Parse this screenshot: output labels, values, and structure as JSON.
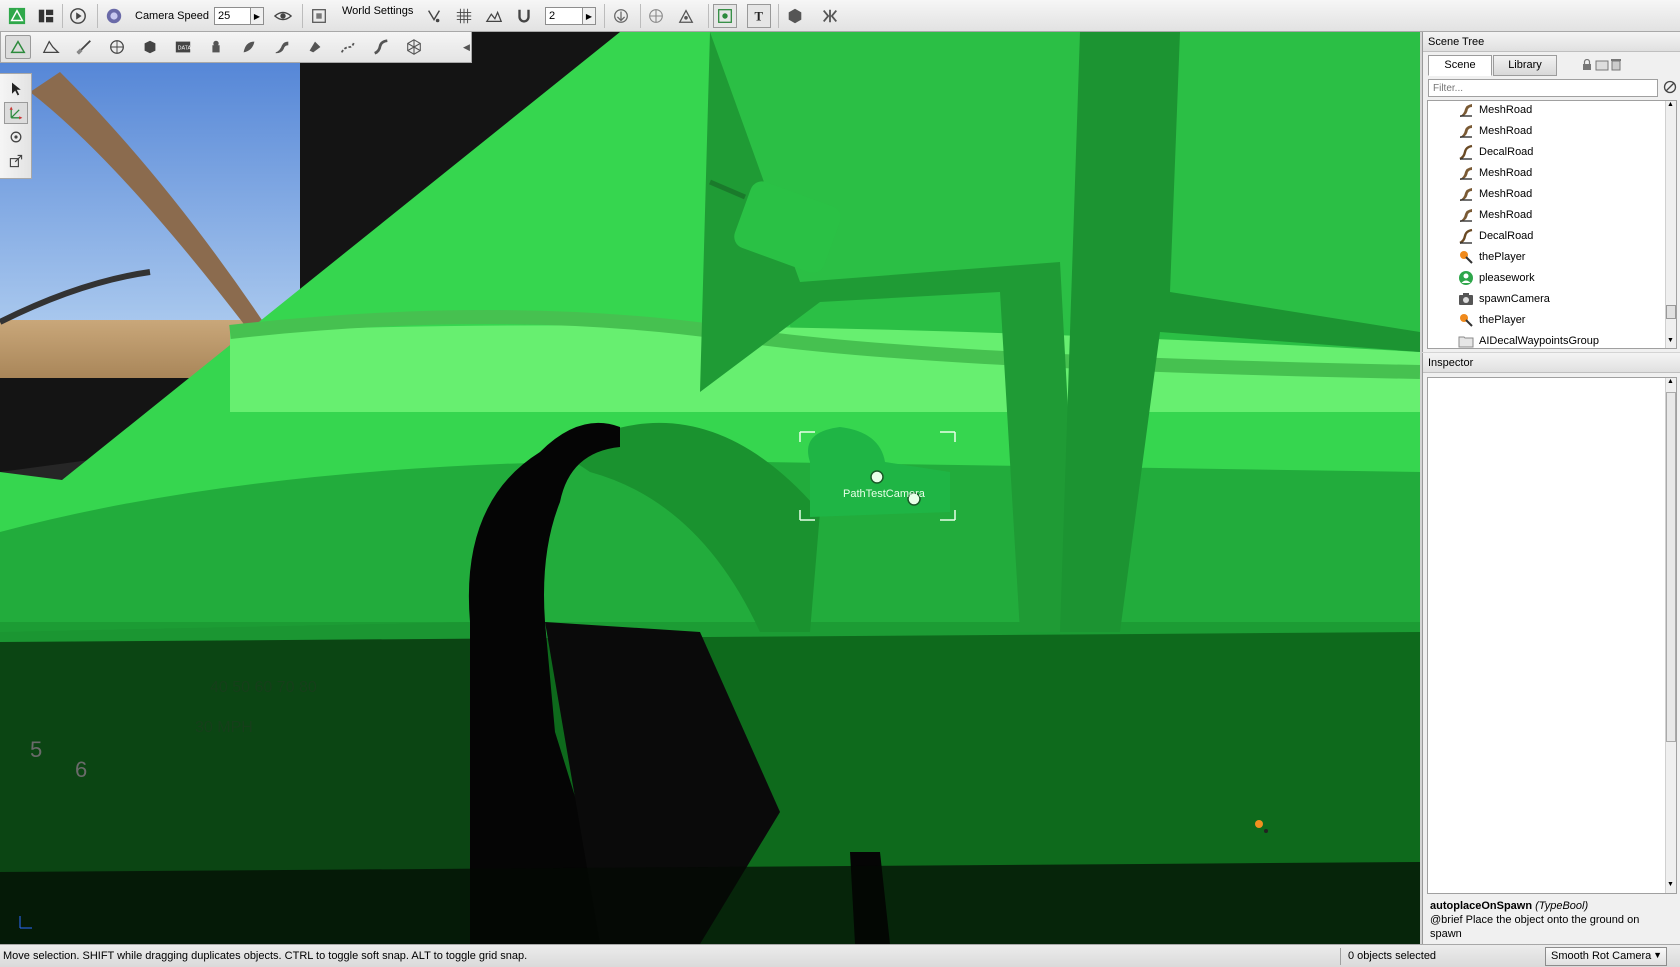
{
  "toolbar": {
    "camera_speed_label": "Camera Speed",
    "camera_speed_value": "25",
    "world_settings_label": "World Settings",
    "snap_value": "2"
  },
  "viewport": {
    "selected_object_label": "PathTestCamera"
  },
  "scene_tree": {
    "title": "Scene Tree",
    "tabs": [
      {
        "label": "Scene",
        "active": true
      },
      {
        "label": "Library",
        "active": false
      }
    ],
    "filter_placeholder": "Filter...",
    "items": [
      {
        "label": "MeshRoad",
        "icon": "mesh-road-icon"
      },
      {
        "label": "MeshRoad",
        "icon": "mesh-road-icon"
      },
      {
        "label": "DecalRoad",
        "icon": "decal-road-icon"
      },
      {
        "label": "MeshRoad",
        "icon": "mesh-road-icon"
      },
      {
        "label": "MeshRoad",
        "icon": "mesh-road-icon"
      },
      {
        "label": "MeshRoad",
        "icon": "mesh-road-icon"
      },
      {
        "label": "DecalRoad",
        "icon": "decal-road-icon"
      },
      {
        "label": "thePlayer",
        "icon": "player-icon"
      },
      {
        "label": "pleasework",
        "icon": "camera-path-icon"
      },
      {
        "label": "spawnCamera",
        "icon": "camera-icon"
      },
      {
        "label": "thePlayer",
        "icon": "player-icon"
      },
      {
        "label": "AIDecalWaypointsGroup",
        "icon": "folder-icon"
      }
    ]
  },
  "inspector": {
    "title": "Inspector",
    "field_name": "autoplaceOnSpawn",
    "field_type": "(TypeBool)",
    "field_doc": "@brief Place the object onto the ground on spawn"
  },
  "status_bar": {
    "message": "Move selection.  SHIFT while dragging duplicates objects.  CTRL to toggle soft snap.  ALT to toggle grid snap.",
    "objects_selected": "0 objects selected",
    "camera_mode": "Smooth Rot Camera"
  },
  "colors": {
    "selection_green": "#2fd14a",
    "sky_blue": "#6b9be0",
    "toolbar_bg": "#e8e8e8"
  }
}
